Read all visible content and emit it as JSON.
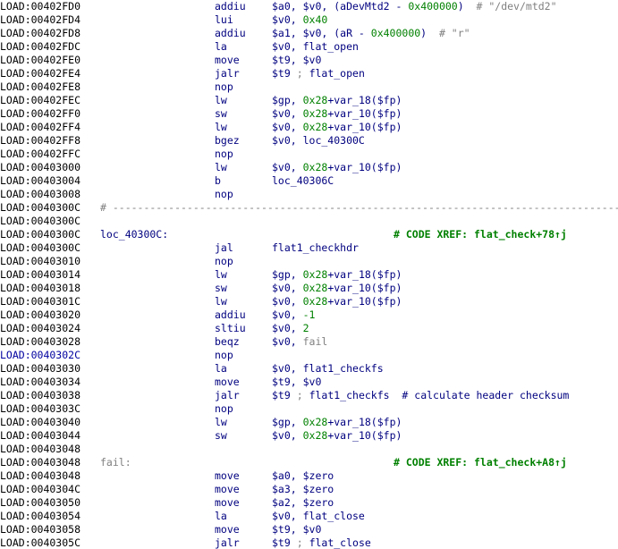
{
  "listing": [
    {
      "addr": "LOAD:00402FD0",
      "mn": "addiu",
      "op": [
        [
          "$a0, $v0, (",
          "name"
        ],
        [
          "aDevMtd2",
          "name"
        ],
        [
          " - ",
          "name"
        ],
        [
          "0x400000",
          "num"
        ],
        [
          ")  ",
          "name"
        ],
        [
          "# \"/dev/mtd2\"",
          "cmt"
        ]
      ]
    },
    {
      "addr": "LOAD:00402FD4",
      "mn": "lui",
      "op": [
        [
          "$v0, ",
          "name"
        ],
        [
          "0x40",
          "num"
        ]
      ]
    },
    {
      "addr": "LOAD:00402FD8",
      "mn": "addiu",
      "op": [
        [
          "$a1, $v0, (aR - ",
          "name"
        ],
        [
          "0x400000",
          "num"
        ],
        [
          ")  ",
          "name"
        ],
        [
          "# \"r\"",
          "cmt"
        ]
      ]
    },
    {
      "addr": "LOAD:00402FDC",
      "mn": "la",
      "op": [
        [
          "$v0, flat_open",
          "name"
        ]
      ]
    },
    {
      "addr": "LOAD:00402FE0",
      "mn": "move",
      "op": [
        [
          "$t9, $v0",
          "name"
        ]
      ]
    },
    {
      "addr": "LOAD:00402FE4",
      "mn": "jalr",
      "op": [
        [
          "$t9 ",
          "name"
        ],
        [
          "; ",
          "cmt"
        ],
        [
          "flat_open",
          "name"
        ]
      ]
    },
    {
      "addr": "LOAD:00402FE8",
      "mn": "nop",
      "op": []
    },
    {
      "addr": "LOAD:00402FEC",
      "mn": "lw",
      "op": [
        [
          "$gp, ",
          "name"
        ],
        [
          "0x28",
          "num"
        ],
        [
          "+var_18($fp)",
          "name"
        ]
      ]
    },
    {
      "addr": "LOAD:00402FF0",
      "mn": "sw",
      "op": [
        [
          "$v0, ",
          "name"
        ],
        [
          "0x28",
          "num"
        ],
        [
          "+var_10($fp)",
          "name"
        ]
      ]
    },
    {
      "addr": "LOAD:00402FF4",
      "mn": "lw",
      "op": [
        [
          "$v0, ",
          "name"
        ],
        [
          "0x28",
          "num"
        ],
        [
          "+var_10($fp)",
          "name"
        ]
      ]
    },
    {
      "addr": "LOAD:00402FF8",
      "mn": "bgez",
      "op": [
        [
          "$v0, loc_40300C",
          "name"
        ]
      ]
    },
    {
      "addr": "LOAD:00402FFC",
      "mn": "nop",
      "op": []
    },
    {
      "addr": "LOAD:00403000",
      "mn": "lw",
      "op": [
        [
          "$v0, ",
          "name"
        ],
        [
          "0x28",
          "num"
        ],
        [
          "+var_10($fp)",
          "name"
        ]
      ]
    },
    {
      "addr": "LOAD:00403004",
      "mn": "b",
      "op": [
        [
          "loc_40306C",
          "name"
        ]
      ]
    },
    {
      "addr": "LOAD:00403008",
      "mn": "nop",
      "op": []
    },
    {
      "addr": "LOAD:0040300C",
      "sep": "# -----------------------------------------------------------------------------------------------"
    },
    {
      "addr": "LOAD:0040300C"
    },
    {
      "addr": "LOAD:0040300C",
      "label": "loc_40300C:",
      "label_style": "name",
      "xref": "# CODE XREF: flat_check+78↑j"
    },
    {
      "addr": "LOAD:0040300C",
      "mn": "jal",
      "op": [
        [
          "flat1_checkhdr",
          "name"
        ]
      ]
    },
    {
      "addr": "LOAD:00403010",
      "mn": "nop",
      "op": []
    },
    {
      "addr": "LOAD:00403014",
      "mn": "lw",
      "op": [
        [
          "$gp, ",
          "name"
        ],
        [
          "0x28",
          "num"
        ],
        [
          "+var_18($fp)",
          "name"
        ]
      ]
    },
    {
      "addr": "LOAD:00403018",
      "mn": "sw",
      "op": [
        [
          "$v0, ",
          "name"
        ],
        [
          "0x28",
          "num"
        ],
        [
          "+var_10($fp)",
          "name"
        ]
      ]
    },
    {
      "addr": "LOAD:0040301C",
      "mn": "lw",
      "op": [
        [
          "$v0, ",
          "name"
        ],
        [
          "0x28",
          "num"
        ],
        [
          "+var_10($fp)",
          "name"
        ]
      ]
    },
    {
      "addr": "LOAD:00403020",
      "mn": "addiu",
      "op": [
        [
          "$v0, ",
          "name"
        ],
        [
          "-1",
          "num"
        ]
      ]
    },
    {
      "addr": "LOAD:00403024",
      "mn": "sltiu",
      "op": [
        [
          "$v0, ",
          "name"
        ],
        [
          "2",
          "num"
        ]
      ]
    },
    {
      "addr": "LOAD:00403028",
      "mn": "beqz",
      "op": [
        [
          "$v0, ",
          "name"
        ],
        [
          "fail",
          "gray"
        ]
      ]
    },
    {
      "addr": "LOAD:0040302C",
      "mn": "nop",
      "op": [],
      "highlight": true
    },
    {
      "addr": "LOAD:00403030",
      "mn": "la",
      "op": [
        [
          "$v0, flat1_checkfs",
          "name"
        ]
      ]
    },
    {
      "addr": "LOAD:00403034",
      "mn": "move",
      "op": [
        [
          "$t9, $v0",
          "name"
        ]
      ]
    },
    {
      "addr": "LOAD:00403038",
      "mn": "jalr",
      "op": [
        [
          "$t9 ",
          "name"
        ],
        [
          "; ",
          "cmt"
        ],
        [
          "flat1_checkfs  ",
          "name"
        ],
        [
          "# calculate header checksum",
          "name"
        ]
      ]
    },
    {
      "addr": "LOAD:0040303C",
      "mn": "nop",
      "op": []
    },
    {
      "addr": "LOAD:00403040",
      "mn": "lw",
      "op": [
        [
          "$gp, ",
          "name"
        ],
        [
          "0x28",
          "num"
        ],
        [
          "+var_18($fp)",
          "name"
        ]
      ]
    },
    {
      "addr": "LOAD:00403044",
      "mn": "sw",
      "op": [
        [
          "$v0, ",
          "name"
        ],
        [
          "0x28",
          "num"
        ],
        [
          "+var_10($fp)",
          "name"
        ]
      ]
    },
    {
      "addr": "LOAD:00403048"
    },
    {
      "addr": "LOAD:00403048",
      "label": "fail:",
      "label_style": "gray",
      "xref": "# CODE XREF: flat_check+A8↑j"
    },
    {
      "addr": "LOAD:00403048",
      "mn": "move",
      "op": [
        [
          "$a0, $zero",
          "name"
        ]
      ]
    },
    {
      "addr": "LOAD:0040304C",
      "mn": "move",
      "op": [
        [
          "$a3, $zero",
          "name"
        ]
      ]
    },
    {
      "addr": "LOAD:00403050",
      "mn": "move",
      "op": [
        [
          "$a2, $zero",
          "name"
        ]
      ]
    },
    {
      "addr": "LOAD:00403054",
      "mn": "la",
      "op": [
        [
          "$v0, flat_close",
          "name"
        ]
      ]
    },
    {
      "addr": "LOAD:00403058",
      "mn": "move",
      "op": [
        [
          "$t9, $v0",
          "name"
        ]
      ]
    },
    {
      "addr": "LOAD:0040305C",
      "mn": "jalr",
      "op": [
        [
          "$t9 ",
          "name"
        ],
        [
          "; ",
          "cmt"
        ],
        [
          "flat_close",
          "name"
        ]
      ]
    }
  ]
}
